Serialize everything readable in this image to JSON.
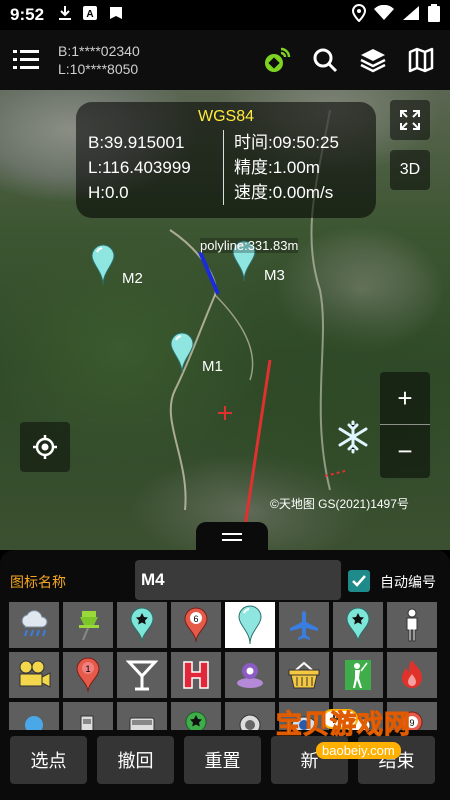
{
  "status_bar": {
    "time": "9:52"
  },
  "toolbar": {
    "coord_b": "B:1****02340",
    "coord_l": "L:10****8050"
  },
  "info_panel": {
    "datum": "WGS84",
    "lat": "B:39.915001",
    "lon": "L:116.403999",
    "height": "H:0.0",
    "time": "时间:09:50:25",
    "accuracy": "精度:1.00m",
    "speed": "速度:0.00m/s"
  },
  "map": {
    "btn_3d": "3D",
    "markers": [
      "M2",
      "M3",
      "M1"
    ],
    "polyline_label": "polyline:331.83m",
    "copyright": "©天地图 GS(2021)1497号",
    "zoom_in": "+",
    "zoom_out": "−"
  },
  "panel": {
    "name_label": "图标名称",
    "name_value": "M4",
    "auto_number_label": "自动编号",
    "auto_number_checked": true
  },
  "icons": [
    "rain-cloud-icon",
    "pushpin-icon",
    "star-pin-icon",
    "numbered-pin-6-icon",
    "teardrop-pin-icon",
    "airplane-icon",
    "star-pin-icon-2",
    "person-icon",
    "film-camera-icon",
    "numbered-pin-1-icon",
    "cocktail-icon",
    "hospital-h-icon",
    "map-point-icon",
    "basket-icon",
    "golfer-icon",
    "fire-icon",
    "blue-dot-icon",
    "gas-pump-icon",
    "bus-icon",
    "green-star-pin-icon",
    "target-icon",
    "eye-icon",
    "gamepad-icon",
    "numbered-pin-9-icon"
  ],
  "buttons": {
    "select_point": "选点",
    "undo": "撤回",
    "reset": "重置",
    "new": "新",
    "finish": "结束"
  },
  "watermark": {
    "title": "宝贝游戏网",
    "url": "baobeiy.com"
  },
  "colors": {
    "accent": "#f5a623",
    "checkbox": "#1f8a8a",
    "info_title": "#ffeb3b",
    "gps_icon": "#7ed321"
  }
}
